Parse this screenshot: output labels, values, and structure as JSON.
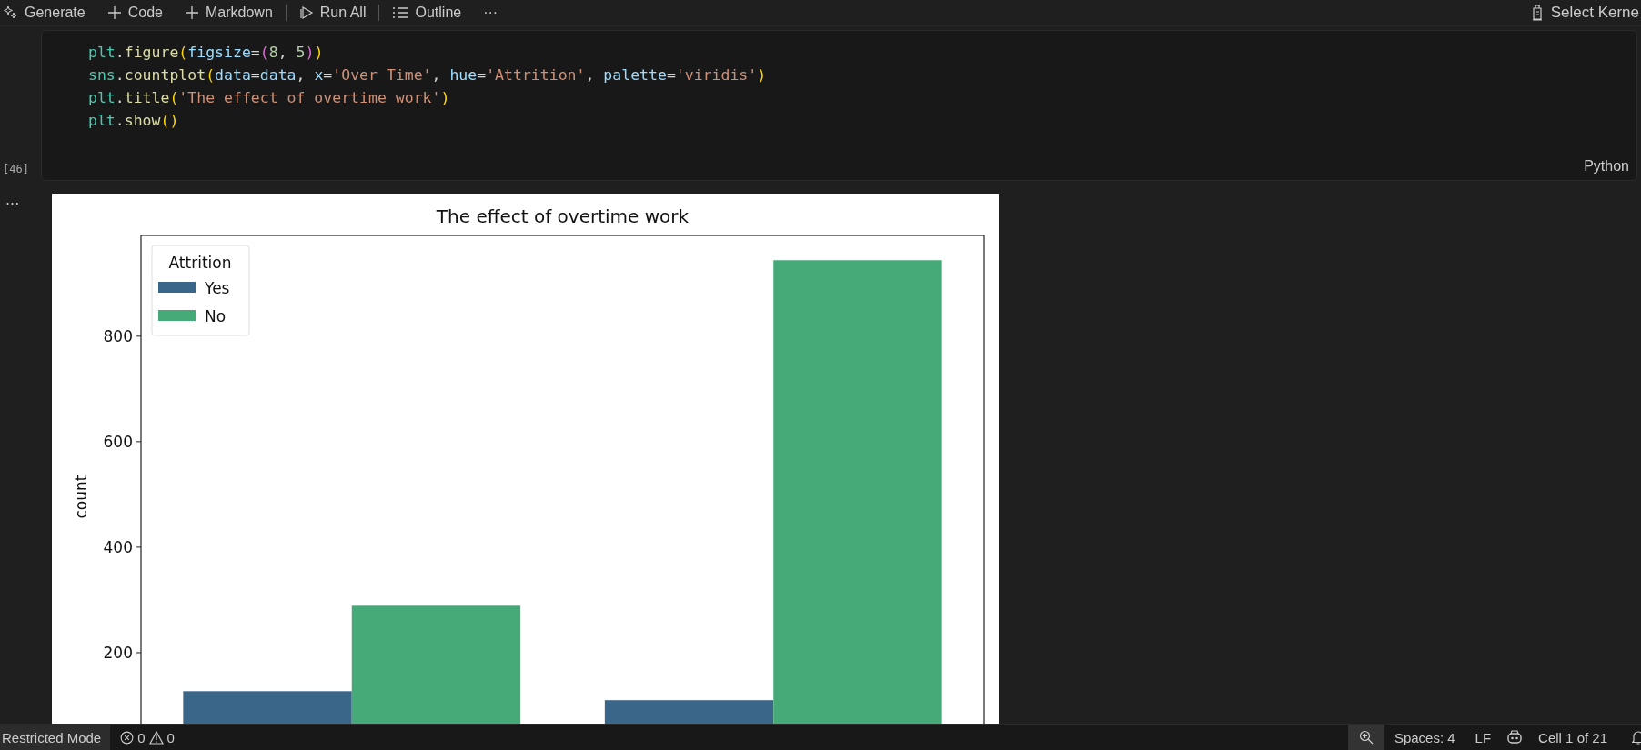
{
  "toolbar": {
    "left": [
      {
        "label": "Generate",
        "kind": "sparkle"
      },
      {
        "label": "Code",
        "kind": "plus"
      },
      {
        "label": "Markdown",
        "kind": "plus"
      },
      {
        "label": "Run All",
        "kind": "play",
        "sep_before": true
      },
      {
        "label": "Outline",
        "kind": "list",
        "sep_before": true
      },
      {
        "label": "···",
        "kind": "more"
      }
    ],
    "kernel": "Select Kerne"
  },
  "cell": {
    "execution_count": "[46]",
    "language": "Python",
    "lines": [
      [
        {
          "t": "plt",
          "kind": "var"
        },
        {
          "t": ".",
          "kind": "plain"
        },
        {
          "t": "figure",
          "kind": "func"
        },
        {
          "t": "(",
          "kind": "p1"
        },
        {
          "t": "figsize",
          "kind": "param"
        },
        {
          "t": "=",
          "kind": "plain"
        },
        {
          "t": "(",
          "kind": "p2"
        },
        {
          "t": "8",
          "kind": "num"
        },
        {
          "t": ", ",
          "kind": "plain"
        },
        {
          "t": "5",
          "kind": "num"
        },
        {
          "t": ")",
          "kind": "p2"
        },
        {
          "t": ")",
          "kind": "p1"
        }
      ],
      [
        {
          "t": "sns",
          "kind": "var"
        },
        {
          "t": ".",
          "kind": "plain"
        },
        {
          "t": "countplot",
          "kind": "func"
        },
        {
          "t": "(",
          "kind": "p1"
        },
        {
          "t": "data",
          "kind": "param"
        },
        {
          "t": "=",
          "kind": "plain"
        },
        {
          "t": "data",
          "kind": "param"
        },
        {
          "t": ", ",
          "kind": "plain"
        },
        {
          "t": "x",
          "kind": "param"
        },
        {
          "t": "=",
          "kind": "plain"
        },
        {
          "t": "'Over Time'",
          "kind": "str"
        },
        {
          "t": ", ",
          "kind": "plain"
        },
        {
          "t": "hue",
          "kind": "param"
        },
        {
          "t": "=",
          "kind": "plain"
        },
        {
          "t": "'Attrition'",
          "kind": "str"
        },
        {
          "t": ", ",
          "kind": "plain"
        },
        {
          "t": "palette",
          "kind": "param"
        },
        {
          "t": "=",
          "kind": "plain"
        },
        {
          "t": "'viridis'",
          "kind": "str"
        },
        {
          "t": ")",
          "kind": "p1"
        }
      ],
      [
        {
          "t": "plt",
          "kind": "var"
        },
        {
          "t": ".",
          "kind": "plain"
        },
        {
          "t": "title",
          "kind": "func"
        },
        {
          "t": "(",
          "kind": "p1"
        },
        {
          "t": "'The effect of overtime work'",
          "kind": "str"
        },
        {
          "t": ")",
          "kind": "p1"
        }
      ],
      [
        {
          "t": "plt",
          "kind": "var"
        },
        {
          "t": ".",
          "kind": "plain"
        },
        {
          "t": "show",
          "kind": "func"
        },
        {
          "t": "()",
          "kind": "p1"
        }
      ]
    ]
  },
  "output": {
    "gutter": "···",
    "chart_data": {
      "type": "bar",
      "title": "The effect of overtime work",
      "ylabel": "count",
      "ylim": [
        0,
        991
      ],
      "yticks": [
        200,
        400,
        600,
        800
      ],
      "legend": {
        "title": "Attrition"
      },
      "series": [
        {
          "name": "Yes",
          "color": "#3a668a",
          "values": [
            127,
            110
          ]
        },
        {
          "name": "No",
          "color": "#45aa78",
          "values": [
            289,
            944
          ]
        }
      ]
    }
  },
  "status_bar": {
    "mode": "Restricted Mode",
    "errors": "0",
    "warnings": "0",
    "spaces": "Spaces: 4",
    "eol": "LF",
    "cell": "Cell 1 of 21"
  }
}
